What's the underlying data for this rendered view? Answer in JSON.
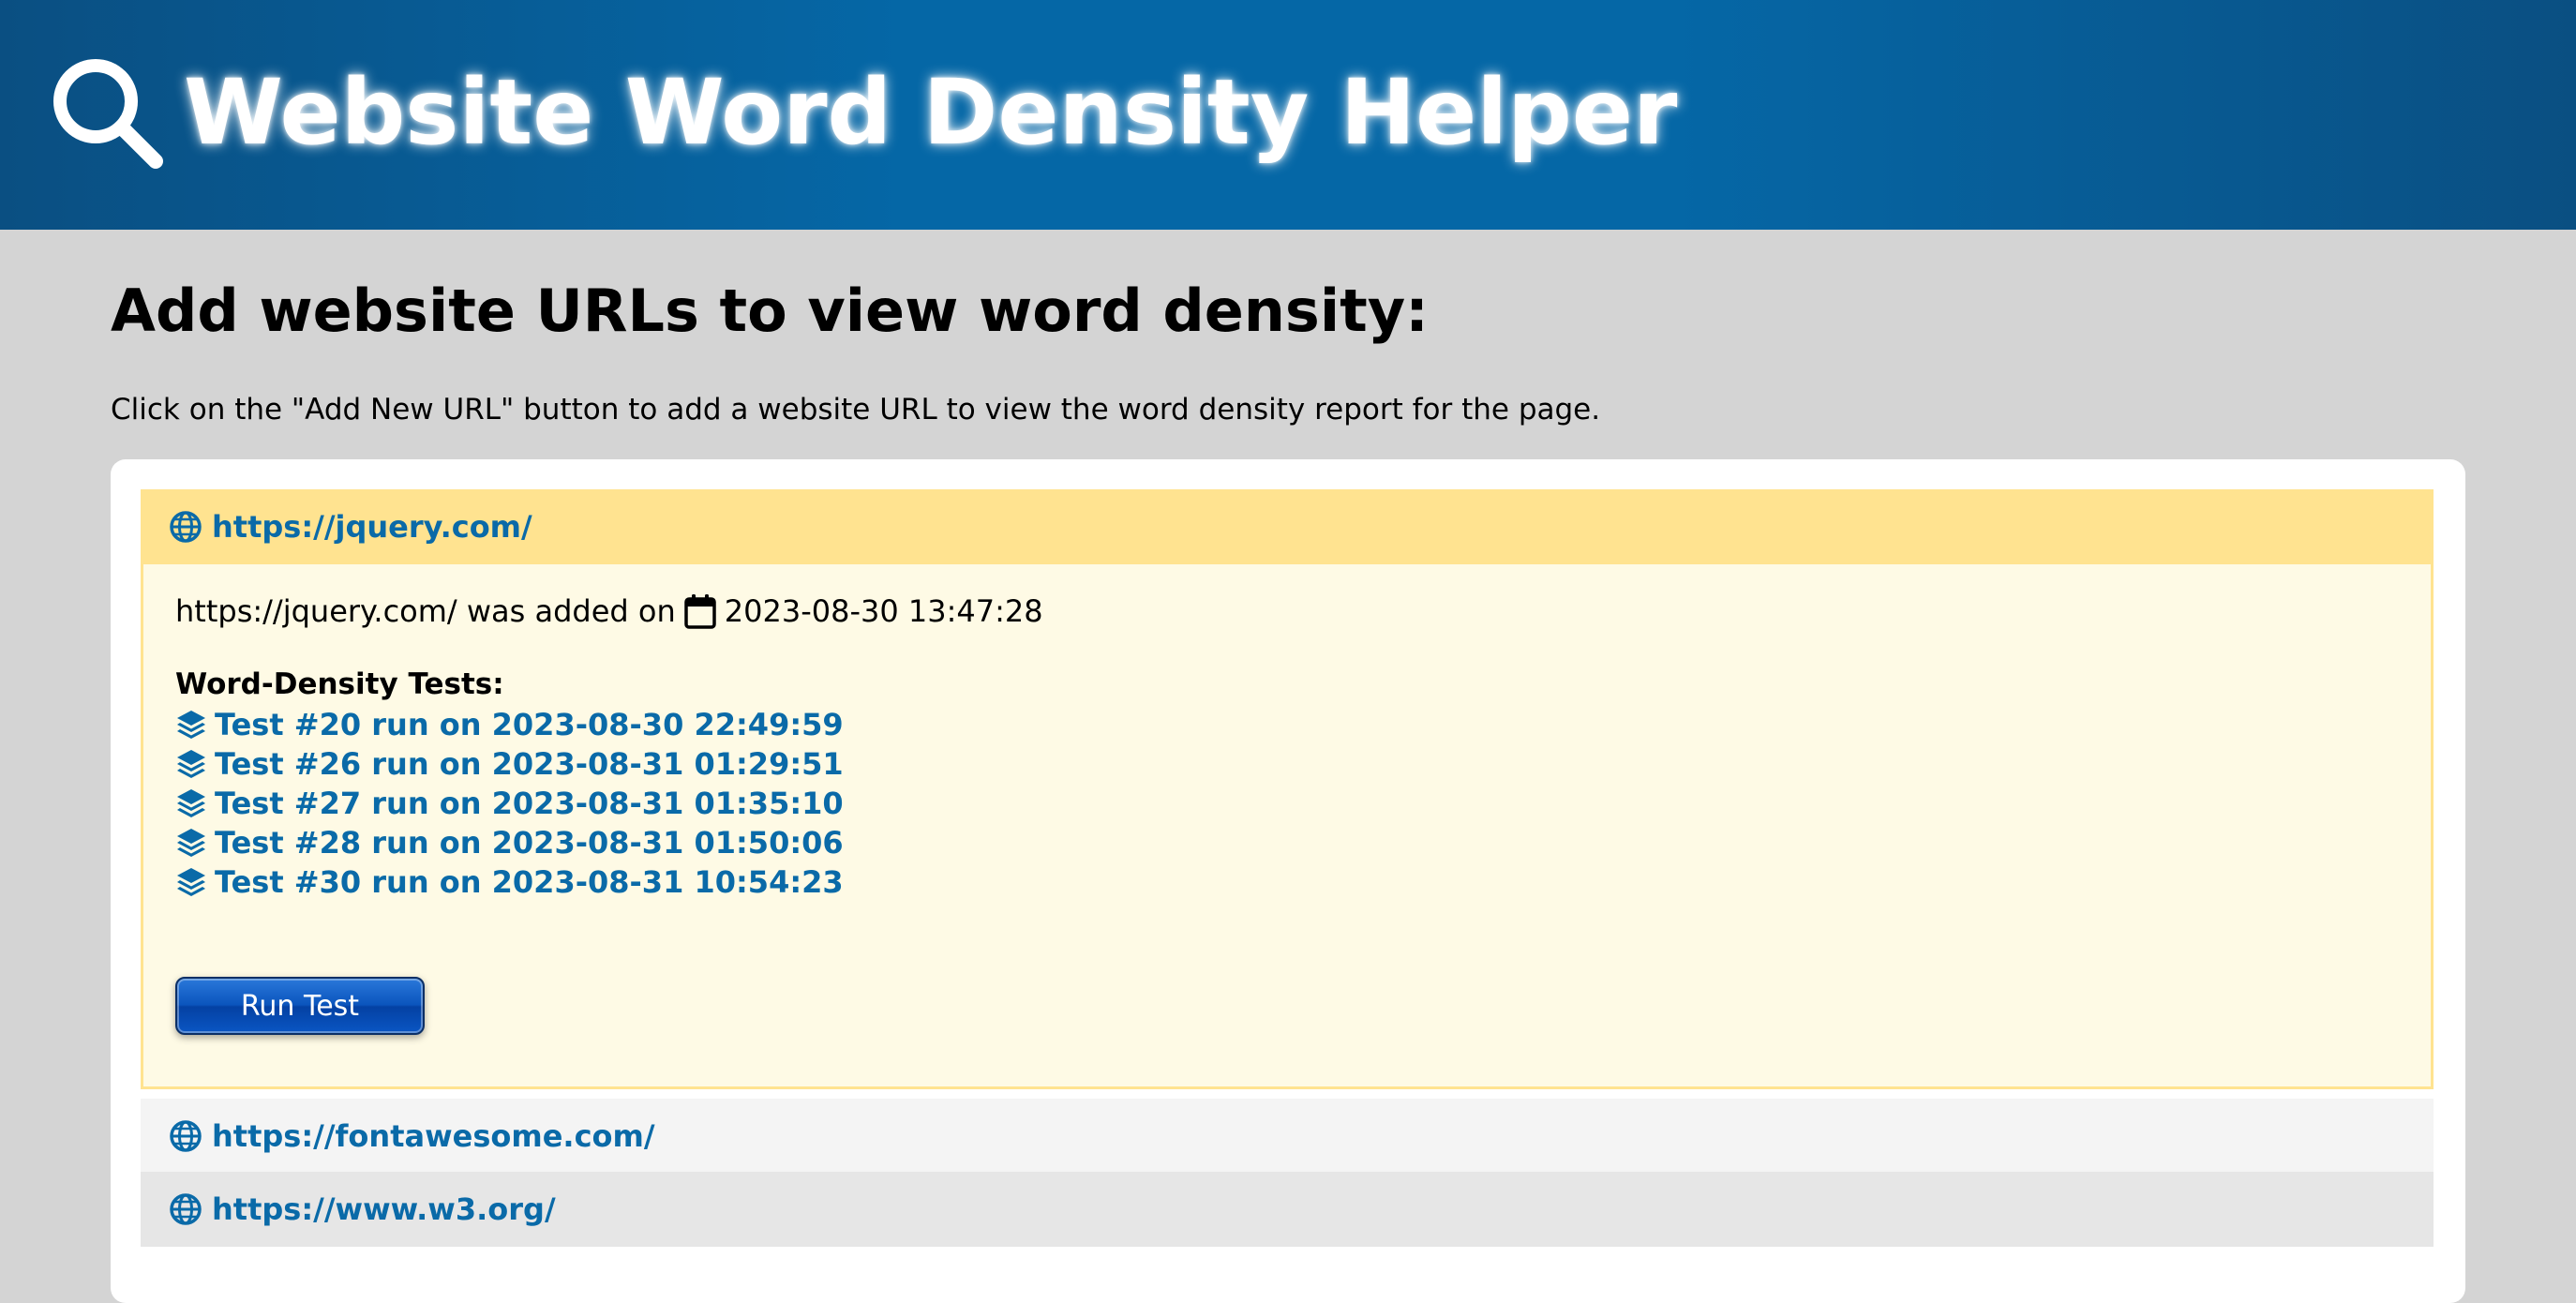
{
  "app": {
    "title": "Website Word Density Helper"
  },
  "page": {
    "heading": "Add website URLs to view word density:",
    "intro": "Click on the \"Add New URL\" button to add a website URL to view the word density report for the page."
  },
  "urls": [
    {
      "url": "https://jquery.com/",
      "expanded": true,
      "added_prefix": "https://jquery.com/ was added on",
      "added_datetime": "2023-08-30 13:47:28",
      "tests_label": "Word-Density Tests:",
      "tests": [
        "Test #20 run on 2023-08-30 22:49:59",
        "Test #26 run on 2023-08-31 01:29:51",
        "Test #27 run on 2023-08-31 01:35:10",
        "Test #28 run on 2023-08-31 01:50:06",
        "Test #30 run on 2023-08-31 10:54:23"
      ],
      "run_button_label": "Run Test"
    },
    {
      "url": "https://fontawesome.com/",
      "expanded": false
    },
    {
      "url": "https://www.w3.org/",
      "expanded": false
    }
  ],
  "icons": {
    "header": "search-icon",
    "url_item": "globe-icon",
    "added_date": "calendar-icon",
    "test_item": "layers-icon"
  },
  "colors": {
    "header_bg": "#0567a6",
    "link": "#0a6aa8",
    "active_header_bg": "#ffe390",
    "active_body_bg": "#fefae5",
    "button_bg": "#0b55bd"
  }
}
